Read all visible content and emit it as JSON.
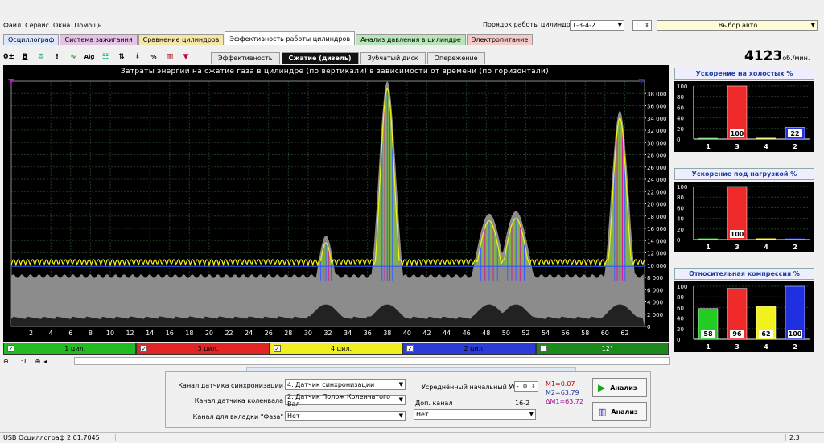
{
  "menu": [
    "Файл",
    "Сервис",
    "Окна",
    "Помощь"
  ],
  "cylinder_order": {
    "label": "Порядок работы цилиндров",
    "value": "1-3-4-2",
    "index": "1"
  },
  "car_select": "Выбор авто",
  "main_tabs": [
    "Осциллограф",
    "Система зажигания",
    "Сравнение цилиндров",
    "Эффективность работы цилиндров",
    "Анализ давления в цилиндре",
    "Электропитание"
  ],
  "main_tab_colors": [
    "#dbe8ff",
    "#e6c3e6",
    "#f5e6a8",
    "#ffffff",
    "#b9e6b9",
    "#f3c9c9"
  ],
  "toolbar_icons": [
    "increment-decrement-icon",
    "bold-b-icon",
    "settings-icon",
    "markers-icon",
    "graph-icon",
    "alg-icon",
    "tree-icon",
    "filter-icon",
    "scale-icon",
    "percent-icon",
    "bars-icon",
    "funnel-icon"
  ],
  "sub_tabs": [
    "Эффективность",
    "Сжатие (дизель)",
    "Зубчатый диск",
    "Опережение"
  ],
  "rpm": {
    "value": "4123",
    "unit": "об./мин."
  },
  "chart": {
    "title": "Затраты энергии на сжатие газа в цилиндре (по вертикали) в зависимости от времени (по горизонтали).",
    "x_ticks": [
      "2",
      "4",
      "6",
      "8",
      "10",
      "12",
      "14",
      "16",
      "18",
      "20",
      "22",
      "24",
      "26",
      "28",
      "30",
      "32",
      "34",
      "36",
      "38",
      "40",
      "42",
      "44",
      "46",
      "48",
      "50",
      "52",
      "54",
      "56",
      "58",
      "60",
      "62"
    ],
    "y_ticks": [
      "0",
      "2 000",
      "4 000",
      "6 000",
      "8 000",
      "10 000",
      "12 000",
      "14 000",
      "16 000",
      "18 000",
      "20 000",
      "22 000",
      "24 000",
      "26 000",
      "28 000",
      "30 000",
      "32 000",
      "34 000",
      "36 000",
      "38 000"
    ]
  },
  "chart_data": {
    "type": "area",
    "x_range": [
      0,
      64
    ],
    "y_range": [
      0,
      40000
    ],
    "peaks": [
      {
        "x": 31.8,
        "y": 13600
      },
      {
        "x": 38,
        "y": 38800
      },
      {
        "x": 48.3,
        "y": 17200
      },
      {
        "x": 51,
        "y": 17600
      },
      {
        "x": 61.5,
        "y": 34000
      }
    ],
    "baseline": 10000
  },
  "channels": [
    {
      "label": "1 цил.",
      "color": "#22bb22",
      "checked": "✓"
    },
    {
      "label": "3 цил.",
      "color": "#e32424",
      "checked": "✓"
    },
    {
      "label": "4 цил.",
      "color": "#f0f020",
      "checked": "✓"
    },
    {
      "label": "2 цил.",
      "color": "#2a3bd8",
      "checked": "✓"
    },
    {
      "label": "12°",
      "color": "#1b8a1b",
      "checked": ""
    }
  ],
  "zoom": "1:1",
  "panels": [
    {
      "title": "Ускорение на холостых %",
      "values": [
        0,
        100,
        0,
        22
      ],
      "labels": [
        "",
        "100",
        "",
        "22"
      ]
    },
    {
      "title": "Ускорение под нагрузкой %",
      "values": [
        0,
        100,
        0,
        0
      ],
      "labels": [
        "",
        "100",
        "",
        ""
      ]
    },
    {
      "title": "Относительная компрессия %",
      "values": [
        58,
        96,
        62,
        100
      ],
      "labels": [
        "58",
        "96",
        "62",
        "100"
      ]
    }
  ],
  "panel_y_ticks": [
    "100",
    "80",
    "60",
    "40",
    "20",
    "0"
  ],
  "cyl_order_labels": [
    "1",
    "3",
    "4",
    "2"
  ],
  "bar_colors": [
    "#22cc22",
    "#ee2a2a",
    "#f2f21e",
    "#2030e0"
  ],
  "controls": {
    "sync_label": "Канал датчика синхронизации",
    "sync_value": "4. Датчик синхронизации",
    "crank_label": "Канал датчика коленвала",
    "crank_value": "2. Датчик Полож Коленчатого Вал",
    "phase_label": "Канал для вкладки \"Фаза\"",
    "phase_value": "Нет",
    "uoz_label": "Усреднённый начальный УОЗ",
    "uoz_value": "-10",
    "extra_label": "Доп. канал",
    "extra_code": "16-2",
    "extra_value": "Нет",
    "m1": "M1=0.07",
    "m2": "M2=63.79",
    "dm": "ΔM1=63.72",
    "analyze1": "Анализ",
    "analyze2": "Анализ"
  },
  "status": {
    "app": "USB Осциллограф  2.01.7045",
    "right": "2.3"
  }
}
